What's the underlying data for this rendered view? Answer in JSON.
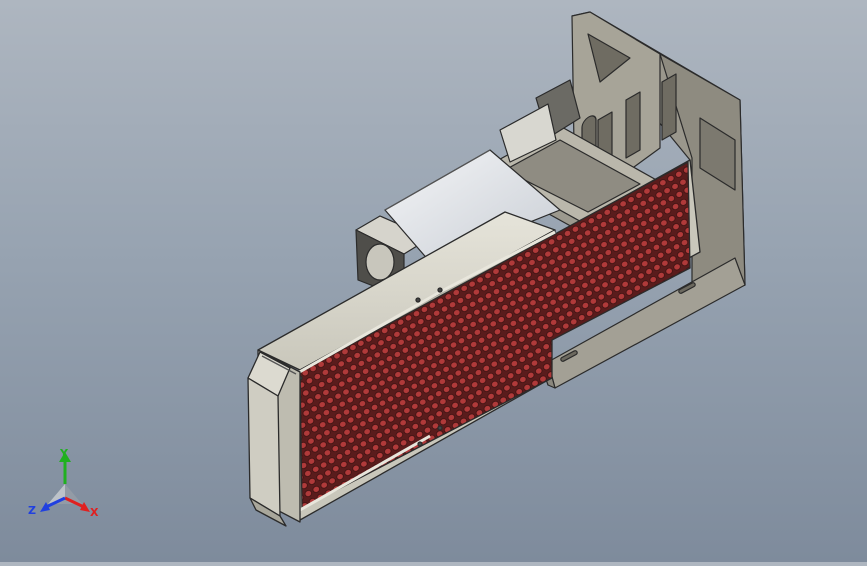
{
  "viewport": {
    "background_top": "#aeb6c0",
    "background_bottom": "#7e8b9c",
    "model": "radiator-with-bracket-assembly",
    "fin_color": "#8f2a2a",
    "frame_color": "#d4d2c6",
    "edge_color": "#2b2b2b"
  },
  "triad": {
    "x_label": "X",
    "y_label": "Y",
    "z_label": "Z",
    "x_color": "#e02020",
    "y_color": "#20b020",
    "z_color": "#2040e0"
  }
}
